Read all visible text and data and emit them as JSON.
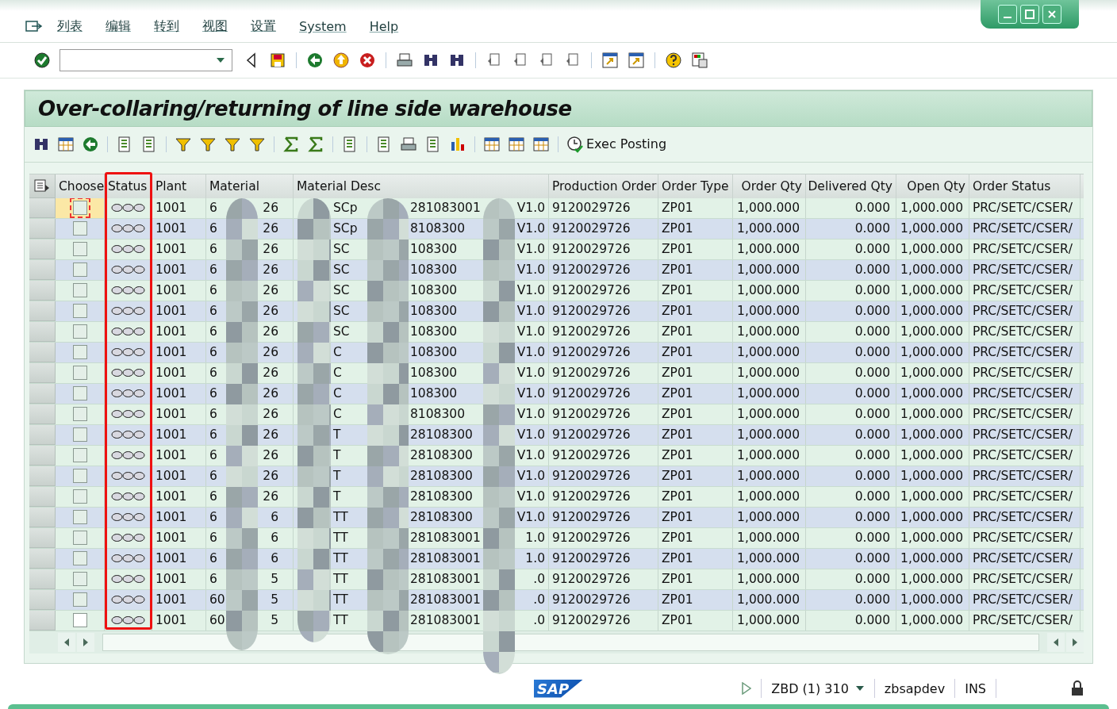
{
  "menu": [
    {
      "label": "列表"
    },
    {
      "label": "编辑"
    },
    {
      "label": "转到"
    },
    {
      "label": "视图"
    },
    {
      "label": "设置"
    },
    {
      "label": "System"
    },
    {
      "label": "Help"
    }
  ],
  "title": "Over-collaring/returning of line side warehouse",
  "app_toolbar": {
    "button": "Exec Posting"
  },
  "table": {
    "columns": [
      "Choose",
      "Status",
      "Plant",
      "Material",
      "Material Desc",
      "Production Order",
      "Order Type",
      "Order Qty",
      "Delivered Qty",
      "Open Qty",
      "Order Status"
    ],
    "rows": [
      {
        "selected": true,
        "checked": false,
        "plant": "1001",
        "material": [
          "6",
          "26"
        ],
        "desc": [
          "SCp",
          "281083001",
          "V1.0"
        ],
        "production_order": "9120029726",
        "order_type": "ZP01",
        "order_qty": "1,000.000",
        "delivered_qty": "0.000",
        "open_qty": "1,000.000",
        "order_status": "PRC/SETC/CSER/"
      },
      {
        "selected": false,
        "checked": false,
        "plant": "1001",
        "material": [
          "6",
          "26"
        ],
        "desc": [
          "SCp",
          "8108300",
          "V1.0"
        ],
        "production_order": "9120029726",
        "order_type": "ZP01",
        "order_qty": "1,000.000",
        "delivered_qty": "0.000",
        "open_qty": "1,000.000",
        "order_status": "PRC/SETC/CSER/"
      },
      {
        "selected": false,
        "checked": false,
        "plant": "1001",
        "material": [
          "6",
          "26"
        ],
        "desc": [
          "SC",
          "108300",
          "V1.0"
        ],
        "production_order": "9120029726",
        "order_type": "ZP01",
        "order_qty": "1,000.000",
        "delivered_qty": "0.000",
        "open_qty": "1,000.000",
        "order_status": "PRC/SETC/CSER/"
      },
      {
        "selected": false,
        "checked": false,
        "plant": "1001",
        "material": [
          "6",
          "26"
        ],
        "desc": [
          "SC",
          "108300",
          "V1.0"
        ],
        "production_order": "9120029726",
        "order_type": "ZP01",
        "order_qty": "1,000.000",
        "delivered_qty": "0.000",
        "open_qty": "1,000.000",
        "order_status": "PRC/SETC/CSER/"
      },
      {
        "selected": false,
        "checked": false,
        "plant": "1001",
        "material": [
          "6",
          "26"
        ],
        "desc": [
          "SC",
          "108300",
          "V1.0"
        ],
        "production_order": "9120029726",
        "order_type": "ZP01",
        "order_qty": "1,000.000",
        "delivered_qty": "0.000",
        "open_qty": "1,000.000",
        "order_status": "PRC/SETC/CSER/"
      },
      {
        "selected": false,
        "checked": false,
        "plant": "1001",
        "material": [
          "6",
          "26"
        ],
        "desc": [
          "SC",
          "108300",
          "V1.0"
        ],
        "production_order": "9120029726",
        "order_type": "ZP01",
        "order_qty": "1,000.000",
        "delivered_qty": "0.000",
        "open_qty": "1,000.000",
        "order_status": "PRC/SETC/CSER/"
      },
      {
        "selected": false,
        "checked": false,
        "plant": "1001",
        "material": [
          "6",
          "26"
        ],
        "desc": [
          "SC",
          "108300",
          "V1.0"
        ],
        "production_order": "9120029726",
        "order_type": "ZP01",
        "order_qty": "1,000.000",
        "delivered_qty": "0.000",
        "open_qty": "1,000.000",
        "order_status": "PRC/SETC/CSER/"
      },
      {
        "selected": false,
        "checked": false,
        "plant": "1001",
        "material": [
          "6",
          "26"
        ],
        "desc": [
          "C",
          "108300",
          "V1.0"
        ],
        "production_order": "9120029726",
        "order_type": "ZP01",
        "order_qty": "1,000.000",
        "delivered_qty": "0.000",
        "open_qty": "1,000.000",
        "order_status": "PRC/SETC/CSER/"
      },
      {
        "selected": false,
        "checked": false,
        "plant": "1001",
        "material": [
          "6",
          "26"
        ],
        "desc": [
          "C",
          "108300",
          "V1.0"
        ],
        "production_order": "9120029726",
        "order_type": "ZP01",
        "order_qty": "1,000.000",
        "delivered_qty": "0.000",
        "open_qty": "1,000.000",
        "order_status": "PRC/SETC/CSER/"
      },
      {
        "selected": false,
        "checked": false,
        "plant": "1001",
        "material": [
          "6",
          "26"
        ],
        "desc": [
          "C",
          "108300",
          "V1.0"
        ],
        "production_order": "9120029726",
        "order_type": "ZP01",
        "order_qty": "1,000.000",
        "delivered_qty": "0.000",
        "open_qty": "1,000.000",
        "order_status": "PRC/SETC/CSER/"
      },
      {
        "selected": false,
        "checked": false,
        "plant": "1001",
        "material": [
          "6",
          "26"
        ],
        "desc": [
          "C",
          "8108300",
          "V1.0"
        ],
        "production_order": "9120029726",
        "order_type": "ZP01",
        "order_qty": "1,000.000",
        "delivered_qty": "0.000",
        "open_qty": "1,000.000",
        "order_status": "PRC/SETC/CSER/"
      },
      {
        "selected": false,
        "checked": false,
        "plant": "1001",
        "material": [
          "6",
          "26"
        ],
        "desc": [
          "T",
          "28108300",
          "V1.0"
        ],
        "production_order": "9120029726",
        "order_type": "ZP01",
        "order_qty": "1,000.000",
        "delivered_qty": "0.000",
        "open_qty": "1,000.000",
        "order_status": "PRC/SETC/CSER/"
      },
      {
        "selected": false,
        "checked": false,
        "plant": "1001",
        "material": [
          "6",
          "26"
        ],
        "desc": [
          "T",
          "28108300",
          "V1.0"
        ],
        "production_order": "9120029726",
        "order_type": "ZP01",
        "order_qty": "1,000.000",
        "delivered_qty": "0.000",
        "open_qty": "1,000.000",
        "order_status": "PRC/SETC/CSER/"
      },
      {
        "selected": false,
        "checked": false,
        "plant": "1001",
        "material": [
          "6",
          "26"
        ],
        "desc": [
          "T",
          "28108300",
          "V1.0"
        ],
        "production_order": "9120029726",
        "order_type": "ZP01",
        "order_qty": "1,000.000",
        "delivered_qty": "0.000",
        "open_qty": "1,000.000",
        "order_status": "PRC/SETC/CSER/"
      },
      {
        "selected": false,
        "checked": false,
        "plant": "1001",
        "material": [
          "6",
          "26"
        ],
        "desc": [
          "T",
          "28108300",
          "V1.0"
        ],
        "production_order": "9120029726",
        "order_type": "ZP01",
        "order_qty": "1,000.000",
        "delivered_qty": "0.000",
        "open_qty": "1,000.000",
        "order_status": "PRC/SETC/CSER/"
      },
      {
        "selected": false,
        "checked": false,
        "plant": "1001",
        "material": [
          "6",
          "6"
        ],
        "desc": [
          "TT",
          "28108300",
          "V1.0"
        ],
        "production_order": "9120029726",
        "order_type": "ZP01",
        "order_qty": "1,000.000",
        "delivered_qty": "0.000",
        "open_qty": "1,000.000",
        "order_status": "PRC/SETC/CSER/"
      },
      {
        "selected": false,
        "checked": false,
        "plant": "1001",
        "material": [
          "6",
          "6"
        ],
        "desc": [
          "TT",
          "281083001",
          "1.0"
        ],
        "production_order": "9120029726",
        "order_type": "ZP01",
        "order_qty": "1,000.000",
        "delivered_qty": "0.000",
        "open_qty": "1,000.000",
        "order_status": "PRC/SETC/CSER/"
      },
      {
        "selected": false,
        "checked": false,
        "plant": "1001",
        "material": [
          "6",
          "6"
        ],
        "desc": [
          "TT",
          "281083001",
          "1.0"
        ],
        "production_order": "9120029726",
        "order_type": "ZP01",
        "order_qty": "1,000.000",
        "delivered_qty": "0.000",
        "open_qty": "1,000.000",
        "order_status": "PRC/SETC/CSER/"
      },
      {
        "selected": false,
        "checked": false,
        "plant": "1001",
        "material": [
          "6",
          "5"
        ],
        "desc": [
          "TT",
          "281083001",
          ".0"
        ],
        "production_order": "9120029726",
        "order_type": "ZP01",
        "order_qty": "1,000.000",
        "delivered_qty": "0.000",
        "open_qty": "1,000.000",
        "order_status": "PRC/SETC/CSER/"
      },
      {
        "selected": false,
        "checked": false,
        "plant": "1001",
        "material": [
          "60",
          "5"
        ],
        "desc": [
          "TT",
          "281083001",
          ".0"
        ],
        "production_order": "9120029726",
        "order_type": "ZP01",
        "order_qty": "1,000.000",
        "delivered_qty": "0.000",
        "open_qty": "1,000.000",
        "order_status": "PRC/SETC/CSER/"
      },
      {
        "selected": false,
        "checked": false,
        "plant": "1001",
        "material": [
          "60",
          "5"
        ],
        "desc": [
          "TT",
          "281083001",
          ".0"
        ],
        "production_order": "9120029726",
        "order_type": "ZP01",
        "order_qty": "1,000.000",
        "delivered_qty": "0.000",
        "open_qty": "1,000.000",
        "order_status": "PRC/SETC/CSER/"
      }
    ]
  },
  "status_bar": {
    "logo": "SAP",
    "system": "ZBD (1) 310",
    "user": "zbsapdev",
    "mode": "INS"
  }
}
